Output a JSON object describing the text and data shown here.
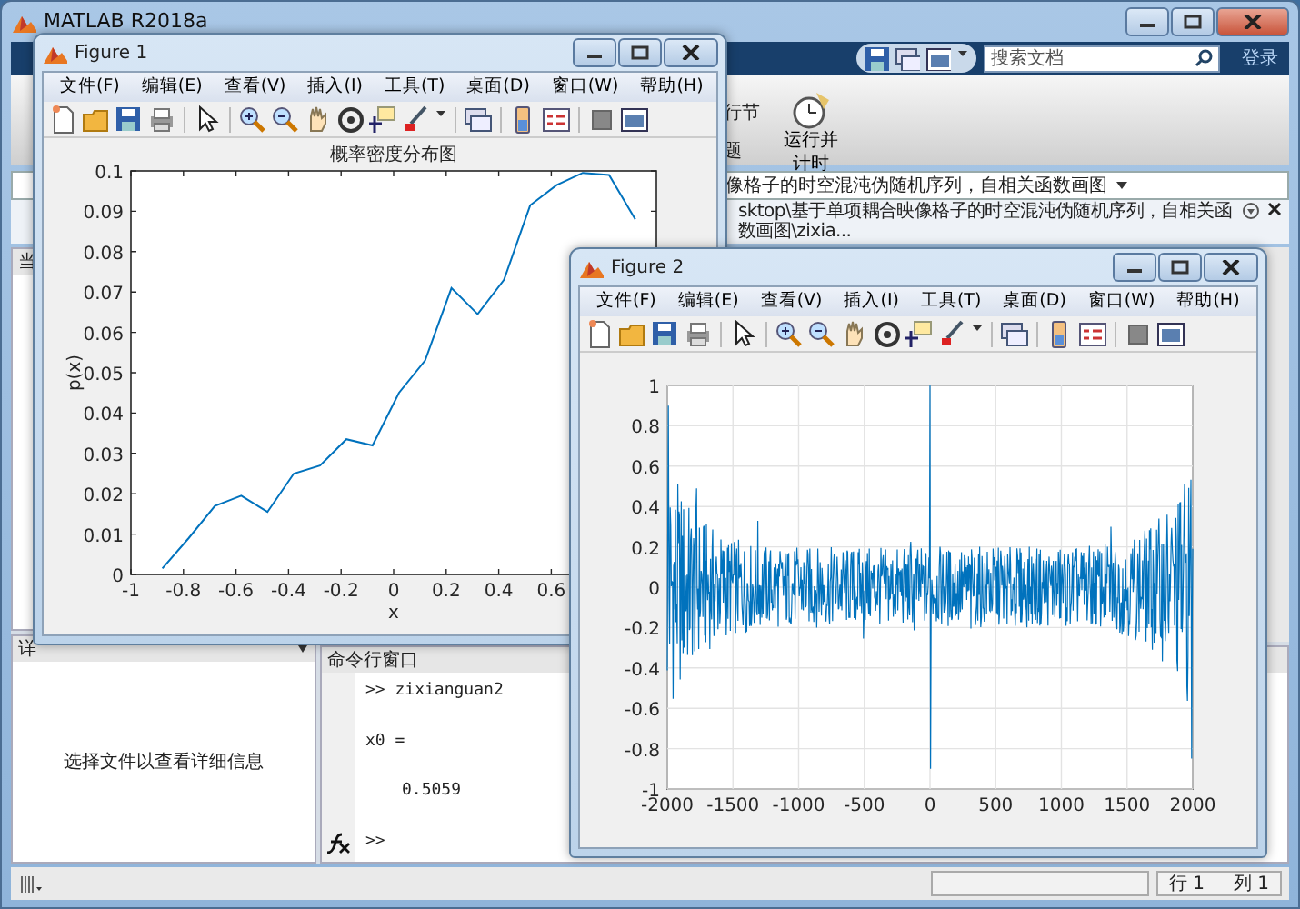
{
  "main_window": {
    "title": "MATLAB R2018a",
    "search": {
      "placeholder": "搜索文档"
    },
    "sign_in": "登录",
    "ribbon_labels": [
      "行节",
      "题"
    ],
    "ribbon_button": "运行并计时",
    "address": "像格子的时空混沌伪随机序列，自相关函数画图",
    "path": "sktop\\基于单项耦合映像格子的时空混沌伪随机序列，自相关函数画图\\zixia...",
    "left_panel_text": "当",
    "details_panel": {
      "title": "详",
      "message": "选择文件以查看详细信息"
    },
    "command_window": {
      "title": "命令行窗口",
      "lines": [
        {
          "kind": "command",
          "text": ">> zixianguan2"
        },
        {
          "kind": "output",
          "text": "x0 ="
        },
        {
          "kind": "value",
          "text": "0.5059"
        }
      ],
      "prompt": ">>"
    },
    "status_bar": {
      "row": "行 1",
      "column": "列 1"
    }
  },
  "figures": [
    {
      "title": "Figure 1",
      "menus": [
        "文件(F)",
        "编辑(E)",
        "查看(V)",
        "插入(I)",
        "工具(T)",
        "桌面(D)",
        "窗口(W)",
        "帮助(H)"
      ],
      "chart_data": {
        "type": "line",
        "title": "概率密度分布图",
        "xlabel": "x",
        "ylabel": "p(x)",
        "xlim": [
          -1,
          1
        ],
        "ylim": [
          0,
          0.1
        ],
        "xticks": [
          -1,
          -0.8,
          -0.6,
          -0.4,
          -0.2,
          0,
          0.2,
          0.4,
          0.6
        ],
        "yticks": [
          0,
          0.01,
          0.02,
          0.03,
          0.04,
          0.05,
          0.06,
          0.07,
          0.08,
          0.09,
          0.1
        ],
        "x": [
          -0.88,
          -0.78,
          -0.68,
          -0.58,
          -0.48,
          -0.38,
          -0.28,
          -0.18,
          -0.08,
          0.02,
          0.12,
          0.22,
          0.32,
          0.42,
          0.52,
          0.62,
          0.72,
          0.82,
          0.92
        ],
        "series": [
          {
            "color": "#0072bd",
            "values": [
              0.0015,
              0.009,
              0.017,
              0.0195,
              0.0155,
              0.025,
              0.027,
              0.0335,
              0.032,
              0.045,
              0.053,
              0.071,
              0.0645,
              0.073,
              0.0915,
              0.0965,
              0.0995,
              0.099,
              0.088
            ]
          }
        ]
      }
    },
    {
      "title": "Figure 2",
      "menus": [
        "文件(F)",
        "编辑(E)",
        "查看(V)",
        "插入(I)",
        "工具(T)",
        "桌面(D)",
        "窗口(W)",
        "帮助(H)"
      ],
      "waveform_plot": {
        "xtick_labels": [
          "-2000",
          "-1500",
          "-1000",
          "-500",
          "0",
          "500",
          "1000",
          "1500",
          "2000"
        ],
        "ytick_labels": [
          "1",
          "0.8",
          "0.6",
          "0.4",
          "0.2",
          "0",
          "-0.2",
          "-0.4",
          "-0.6",
          "-0.8",
          "-1"
        ]
      }
    }
  ]
}
